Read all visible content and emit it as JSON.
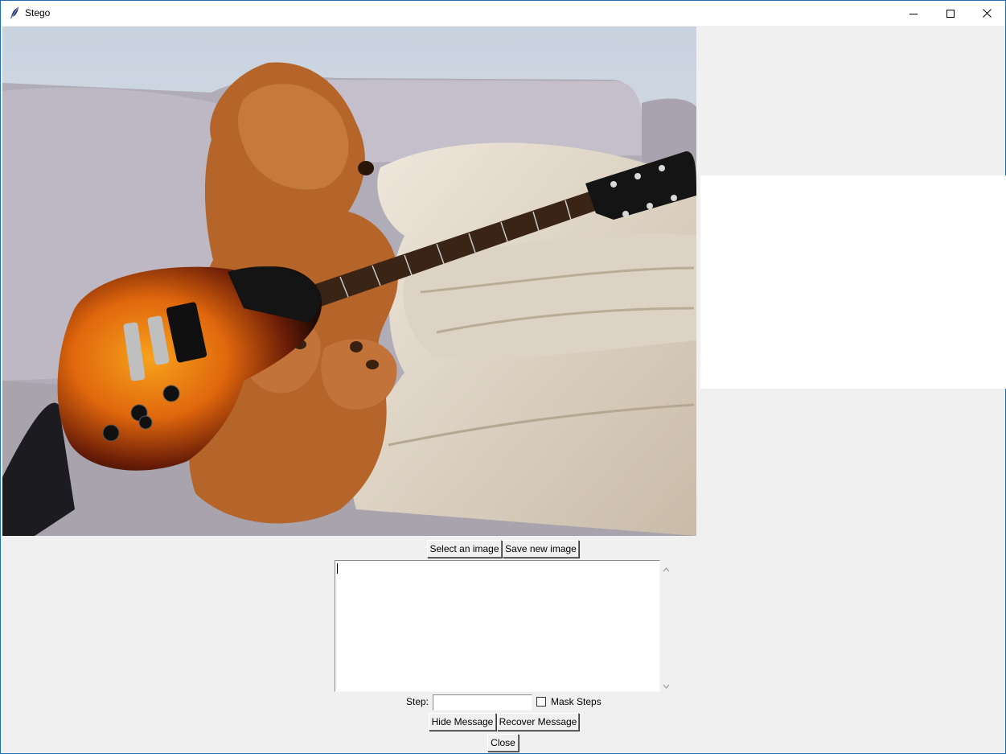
{
  "window": {
    "title": "Stego",
    "icon": "feather-icon"
  },
  "window_controls": {
    "minimize": "minimize-icon",
    "maximize": "maximize-icon",
    "close": "close-icon"
  },
  "image_panel": {
    "description_icon": "photo-preview"
  },
  "buttons": {
    "select_image": "Select an image",
    "save_image": "Save new image",
    "hide_message": "Hide Message",
    "recover_message": "Recover Message",
    "close": "Close"
  },
  "message": {
    "value": ""
  },
  "step": {
    "label": "Step:",
    "value": ""
  },
  "mask_steps": {
    "label": "Mask Steps",
    "checked": false
  },
  "colors": {
    "window_bg": "#f0f0f0",
    "border": "#1f6fb5"
  }
}
